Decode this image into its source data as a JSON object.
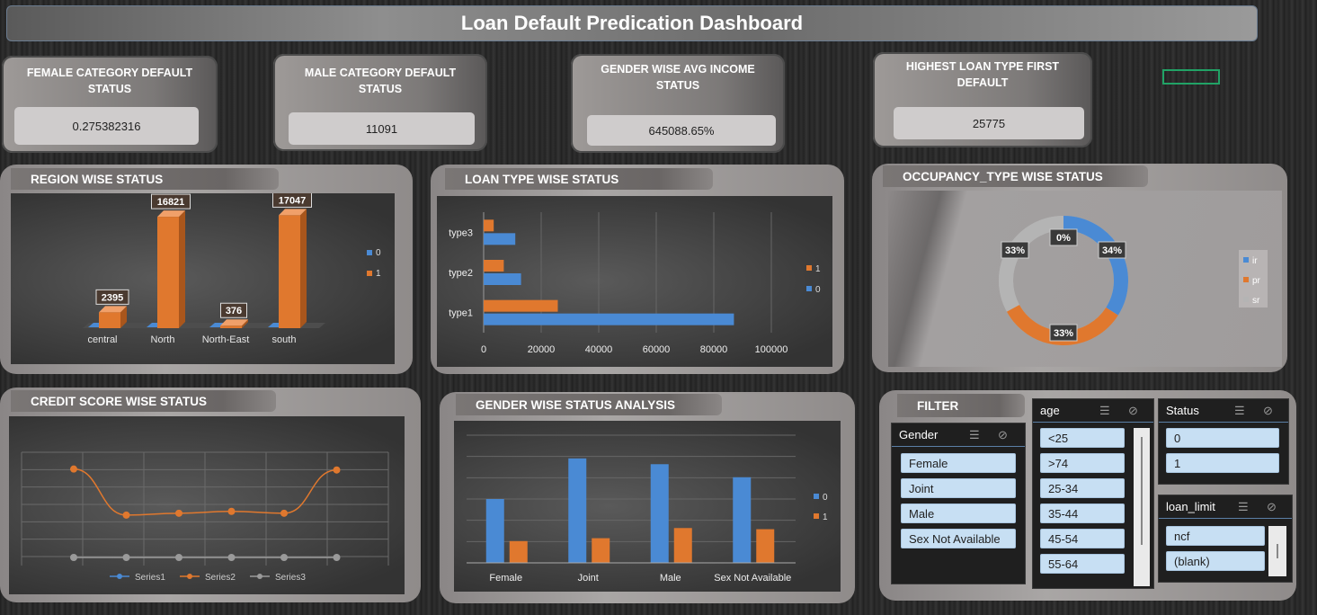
{
  "dashboard": {
    "title": "Loan Default Predication Dashboard"
  },
  "kpis": {
    "female": {
      "label": "FEMALE CATEGORY DEFAULT STATUS",
      "value": "0.275382316"
    },
    "male": {
      "label": "MALE CATEGORY DEFAULT STATUS",
      "value": "11091"
    },
    "income": {
      "label": "GENDER WISE AVG INCOME STATUS",
      "value": "645088.65%"
    },
    "loan_type": {
      "label": "HIGHEST LOAN TYPE FIRST DEFAULT",
      "value": "25775"
    }
  },
  "panels": {
    "region": "REGION WISE STATUS",
    "loan": "LOAN TYPE WISE STATUS",
    "occupancy": "OCCUPANCY_TYPE WISE STATUS",
    "credit": "CREDIT SCORE  WISE STATUS",
    "gender": "GENDER WISE STATUS ANALYSIS",
    "filter": "FILTER"
  },
  "chart_data": [
    {
      "id": "region",
      "type": "bar",
      "title": "REGION WISE STATUS",
      "categories": [
        "central",
        "North",
        "North-East",
        "south"
      ],
      "series": [
        {
          "name": "0",
          "values": [
            0,
            0,
            0,
            0
          ],
          "color": "#4a8ad4"
        },
        {
          "name": "1",
          "values": [
            2395,
            16821,
            376,
            17047
          ],
          "color": "#e0782e"
        }
      ],
      "data_labels": [
        "2395",
        "16821",
        "376",
        "17047"
      ],
      "legend": [
        "0",
        "1"
      ],
      "legend_position": "right",
      "ylim": [
        0,
        18000
      ]
    },
    {
      "id": "loan_type",
      "type": "bar",
      "orientation": "horizontal",
      "title": "LOAN TYPE WISE STATUS",
      "categories": [
        "type1",
        "type2",
        "type3"
      ],
      "series": [
        {
          "name": "0",
          "values": [
            87000,
            13000,
            11000
          ],
          "color": "#4a8ad4"
        },
        {
          "name": "1",
          "values": [
            25775,
            7000,
            3500
          ],
          "color": "#e0782e"
        }
      ],
      "xticks": [
        "0",
        "20000",
        "40000",
        "60000",
        "80000",
        "100000"
      ],
      "xlim": [
        0,
        100000
      ],
      "legend": [
        "1",
        "0"
      ],
      "legend_position": "right",
      "grid": true
    },
    {
      "id": "occupancy",
      "type": "pie",
      "donut": true,
      "title": "OCCUPANCY_TYPE WISE STATUS",
      "labels": [
        "ir",
        "pr",
        "sr"
      ],
      "values": [
        34,
        0,
        33,
        33
      ],
      "slices": [
        {
          "label": "ir",
          "value": 34,
          "text": "34%",
          "color": "#4a8ad4"
        },
        {
          "label": "pr",
          "value": 33,
          "text": "33%",
          "color": "#e0782e"
        },
        {
          "label": "sr",
          "value": 33,
          "text": "33%",
          "color": "#b4b4b4"
        },
        {
          "label": "",
          "value": 0,
          "text": "0%",
          "color": "#4a8ad4"
        }
      ],
      "legend": [
        "ir",
        "pr",
        "sr"
      ],
      "legend_position": "right"
    },
    {
      "id": "credit",
      "type": "line",
      "title": "CREDIT SCORE  WISE STATUS",
      "x": [
        1,
        2,
        3,
        4,
        5,
        6
      ],
      "series": [
        {
          "name": "Series1",
          "values": [
            0,
            0,
            0,
            0,
            0,
            0
          ],
          "color": "#4a8ad4"
        },
        {
          "name": "Series2",
          "values": [
            94,
            45,
            47,
            49,
            47,
            93
          ],
          "color": "#e0782e"
        },
        {
          "name": "Series3",
          "values": [
            0,
            0,
            0,
            0,
            0,
            0
          ],
          "color": "#9a9a9a"
        }
      ],
      "ylim": [
        0,
        130
      ],
      "legend": [
        "Series1",
        "Series2",
        "Series3"
      ],
      "legend_position": "bottom",
      "grid": true
    },
    {
      "id": "gender",
      "type": "bar",
      "title": "GENDER WISE STATUS ANALYSIS",
      "categories": [
        "Female",
        "Joint",
        "Male",
        "Sex Not Available"
      ],
      "series": [
        {
          "name": "0",
          "values": [
            22000,
            36000,
            34000,
            29500
          ],
          "color": "#4a8ad4"
        },
        {
          "name": "1",
          "values": [
            7500,
            8500,
            12000,
            11600
          ],
          "color": "#e0782e"
        }
      ],
      "ylim": [
        0,
        44000
      ],
      "legend": [
        "0",
        "1"
      ],
      "legend_position": "right",
      "grid": true
    }
  ],
  "slicers": {
    "gender": {
      "title": "Gender",
      "items": [
        "Female",
        "Joint",
        "Male",
        "Sex Not Available"
      ]
    },
    "age": {
      "title": "age",
      "items": [
        "<25",
        ">74",
        "25-34",
        "35-44",
        "45-54",
        "55-64"
      ]
    },
    "status": {
      "title": "Status",
      "items": [
        "0",
        "1"
      ]
    },
    "loan_limit": {
      "title": "loan_limit",
      "items": [
        "ncf",
        "(blank)"
      ]
    }
  },
  "icons": {
    "multi_select": "multi-select-icon",
    "clear_filter": "clear-filter-icon"
  }
}
